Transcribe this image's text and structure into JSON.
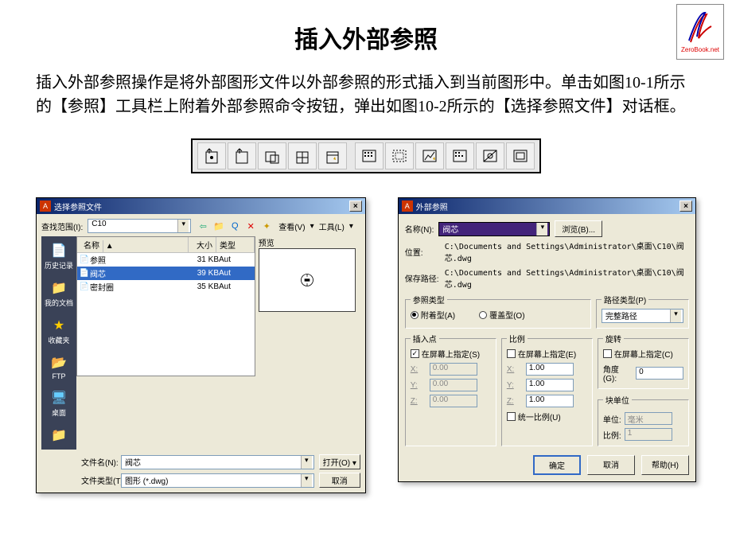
{
  "logo_text": "ZeroBook.net",
  "title": "插入外部参照",
  "description": "插入外部参照操作是将外部图形文件以外部参照的形式插入到当前图形中。单击如图10-1所示的【参照】工具栏上附着外部参照命令按钮，弹出如图10-2所示的【选择参照文件】对话框。",
  "dialog1": {
    "title": "选择参照文件",
    "lookin_label": "查找范围(I):",
    "lookin_value": "C10",
    "view_menu": "查看(V)",
    "tool_menu": "工具(L)",
    "preview_label": "预览",
    "columns": {
      "name": "名称",
      "size": "大小",
      "type": "类型"
    },
    "rows": [
      {
        "name": "参照",
        "size": "31 KB",
        "type": "Aut"
      },
      {
        "name": "阀芯",
        "size": "39 KB",
        "type": "Aut",
        "selected": true
      },
      {
        "name": "密封圈",
        "size": "35 KB",
        "type": "Aut"
      }
    ],
    "sidebar": [
      "历史记录",
      "我的文档",
      "收藏夹",
      "FTP",
      "桌面"
    ],
    "filename_label": "文件名(N):",
    "filename_value": "阀芯",
    "filetype_label": "文件类型(T):",
    "filetype_value": "图形 (*.dwg)",
    "open_btn": "打开(O)",
    "cancel_btn": "取消"
  },
  "dialog2": {
    "title": "外部参照",
    "name_label": "名称(N):",
    "name_value": "阀芯",
    "browse_btn": "浏览(B)...",
    "loc_label": "位置:",
    "loc_value": "C:\\Documents and Settings\\Administrator\\桌面\\C10\\阀芯.dwg",
    "savepath_label": "保存路径:",
    "savepath_value": "C:\\Documents and Settings\\Administrator\\桌面\\C10\\阀芯.dwg",
    "ref_type_group": "参照类型",
    "ref_attach": "附着型(A)",
    "ref_overlay": "覆盖型(O)",
    "path_type_group": "路径类型(P)",
    "path_type_value": "完整路径",
    "insert_group": "插入点",
    "on_screen": "在屏幕上指定(S)",
    "on_screen_e": "在屏幕上指定(E)",
    "on_screen_c": "在屏幕上指定(C)",
    "insert_x": "X:",
    "insert_y": "Y:",
    "insert_z": "Z:",
    "insert_val": "0.00",
    "scale_group": "比例",
    "scale_val": "1.00",
    "uniform": "统一比例(U)",
    "rotate_group": "旋转",
    "angle_label": "角度(G):",
    "angle_val": "0",
    "block_group": "块单位",
    "unit_label": "单位:",
    "unit_val": "毫米",
    "ratio_label": "比例:",
    "ratio_val": "1",
    "ok": "确定",
    "cancel": "取消",
    "help": "帮助(H)"
  }
}
